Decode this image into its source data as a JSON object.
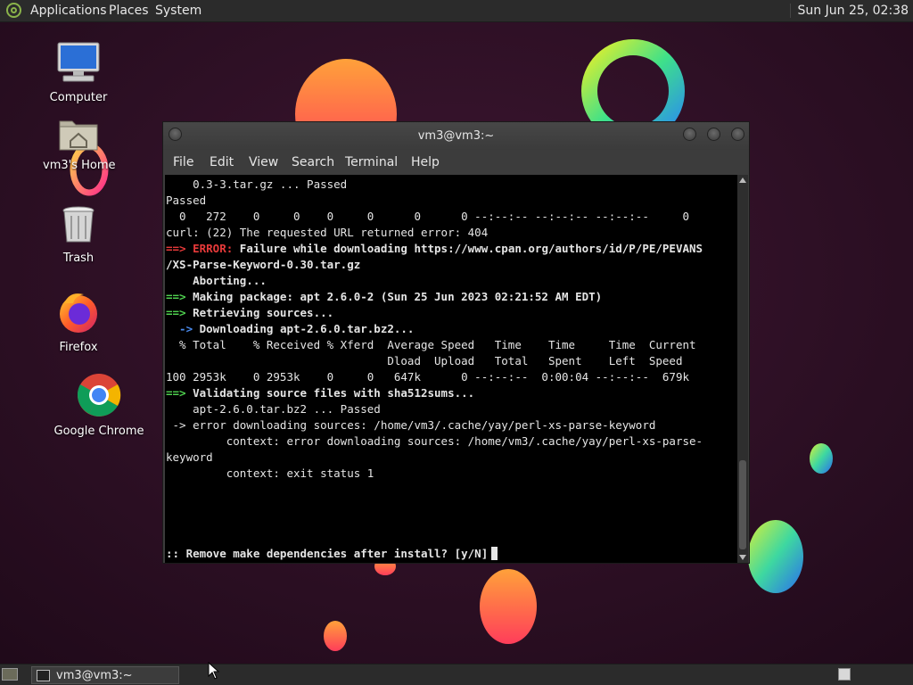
{
  "top_panel": {
    "menus": [
      "Applications",
      "Places",
      "System"
    ],
    "clock": "Sun Jun 25, 02:38"
  },
  "desktop_icons": [
    {
      "label": "Computer",
      "icon": "computer-icon"
    },
    {
      "label": "vm3's Home",
      "icon": "home-folder-icon"
    },
    {
      "label": "Trash",
      "icon": "trash-icon"
    },
    {
      "label": "Firefox",
      "icon": "firefox-icon"
    },
    {
      "label": "Google Chrome",
      "icon": "chrome-icon"
    }
  ],
  "window": {
    "title": "vm3@vm3:~",
    "menus": [
      "File",
      "Edit",
      "View",
      "Search",
      "Terminal",
      "Help"
    ]
  },
  "terminal": {
    "lines": [
      "    0.3-3.tar.gz ... Passed",
      "Passed",
      "  0   272    0     0    0     0      0      0 --:--:-- --:--:-- --:--:--     0",
      "curl: (22) The requested URL returned error: 404",
      [
        "==> ",
        "ERROR:",
        " Failure while downloading https://www.cpan.org/authors/id/P/PE/PEVANS"
      ],
      "/XS-Parse-Keyword-0.30.tar.gz",
      "    Aborting...",
      [
        "==>",
        " Making package: apt 2.6.0-2 (Sun 25 Jun 2023 02:21:52 AM EDT)"
      ],
      [
        "==>",
        " Retrieving sources..."
      ],
      [
        "  ->",
        " Downloading apt-2.6.0.tar.bz2..."
      ],
      "  % Total    % Received % Xferd  Average Speed   Time    Time     Time  Current",
      "                                 Dload  Upload   Total   Spent    Left  Speed",
      "100 2953k    0 2953k    0     0   647k      0 --:--:--  0:00:04 --:--:--  679k",
      [
        "==>",
        " Validating source files with sha512sums..."
      ],
      "    apt-2.6.0.tar.bz2 ... Passed",
      " -> error downloading sources: /home/vm3/.cache/yay/perl-xs-parse-keyword",
      "         context: error downloading sources: /home/vm3/.cache/yay/perl-xs-parse-",
      "keyword",
      "         context: exit status 1"
    ],
    "prompt": ":: Remove make dependencies after install? [y/N]"
  },
  "bottom_panel": {
    "task_label": "vm3@vm3:~"
  }
}
